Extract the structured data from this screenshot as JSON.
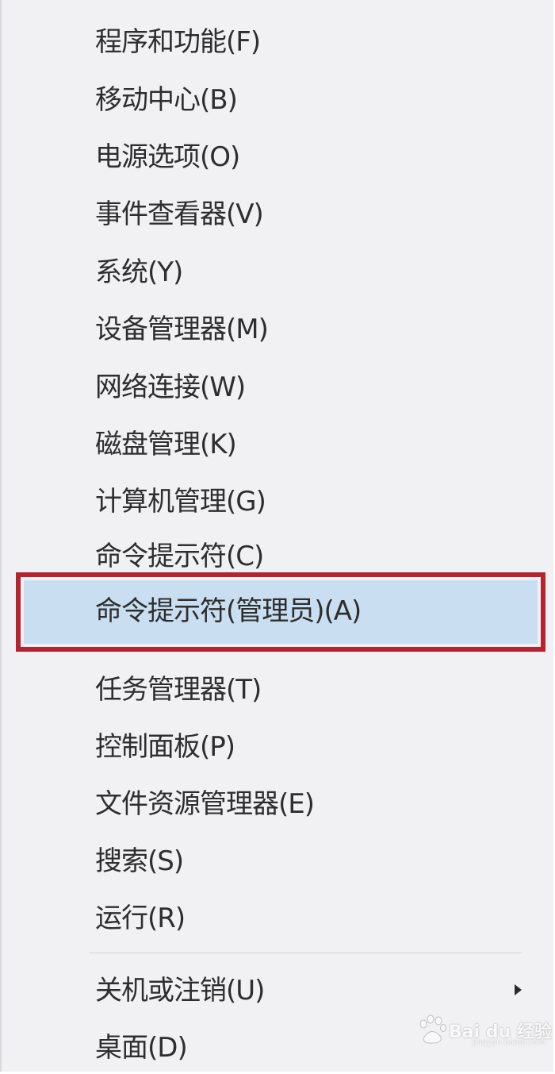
{
  "menu": {
    "items": [
      {
        "label": "程序和功能(F)"
      },
      {
        "label": "移动中心(B)"
      },
      {
        "label": "电源选项(O)"
      },
      {
        "label": "事件查看器(V)"
      },
      {
        "label": "系统(Y)"
      },
      {
        "label": "设备管理器(M)"
      },
      {
        "label": "网络连接(W)"
      },
      {
        "label": "磁盘管理(K)"
      },
      {
        "label": "计算机管理(G)"
      },
      {
        "label": "命令提示符(C)"
      },
      {
        "label": "命令提示符(管理员)(A)",
        "highlighted": true
      },
      {
        "label": "任务管理器(T)"
      },
      {
        "label": "控制面板(P)"
      },
      {
        "label": "文件资源管理器(E)"
      },
      {
        "label": "搜索(S)"
      },
      {
        "label": "运行(R)"
      },
      {
        "label": "关机或注销(U)",
        "has_submenu": true
      },
      {
        "label": "桌面(D)"
      }
    ],
    "highlight_border_color": "#b5232f",
    "highlight_fill_color": "#c9def0"
  },
  "watermark": {
    "text": "Bai du 经验",
    "sub": "jingyan.baidu.com"
  }
}
